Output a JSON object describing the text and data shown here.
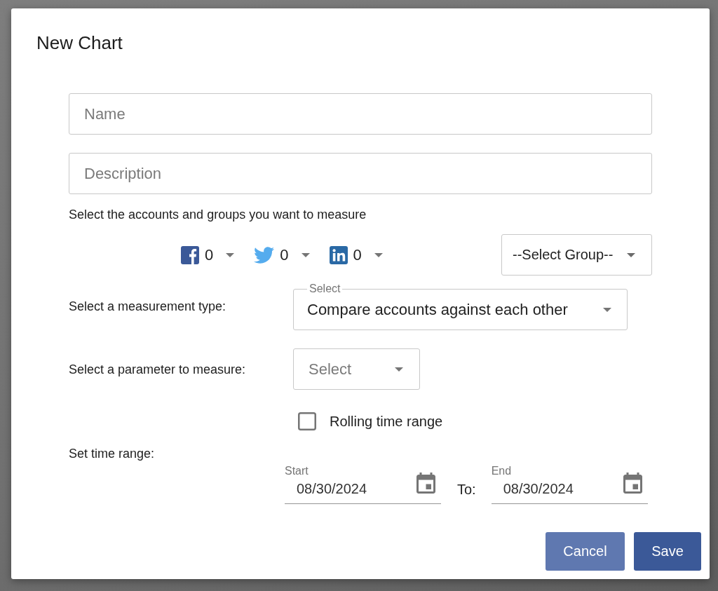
{
  "dialog": {
    "title": "New Chart"
  },
  "fields": [
    {
      "placeholder": "Name"
    },
    {
      "placeholder": "Description"
    }
  ],
  "accounts": {
    "prompt": "Select the accounts and groups you want to measure",
    "networks": [
      {
        "kind": "facebook",
        "count": "0"
      },
      {
        "kind": "twitter",
        "count": "0"
      },
      {
        "kind": "linkedin",
        "count": "0"
      }
    ],
    "group_select": {
      "value": "--Select Group--"
    }
  },
  "measurement": {
    "label": "Select a measurement type:",
    "select_label": "Select",
    "value": "Compare accounts against each other"
  },
  "parameter": {
    "label": "Select a parameter to measure:",
    "placeholder": "Select"
  },
  "rolling": {
    "label": "Rolling time range",
    "checked": false
  },
  "time_range": {
    "label": "Set time range:",
    "start": {
      "label": "Start",
      "value": "08/30/2024"
    },
    "separator": "To:",
    "end": {
      "label": "End",
      "value": "08/30/2024"
    }
  },
  "buttons": [
    {
      "label": "Cancel",
      "kind": "secondary"
    },
    {
      "label": "Save",
      "kind": "primary"
    }
  ]
}
